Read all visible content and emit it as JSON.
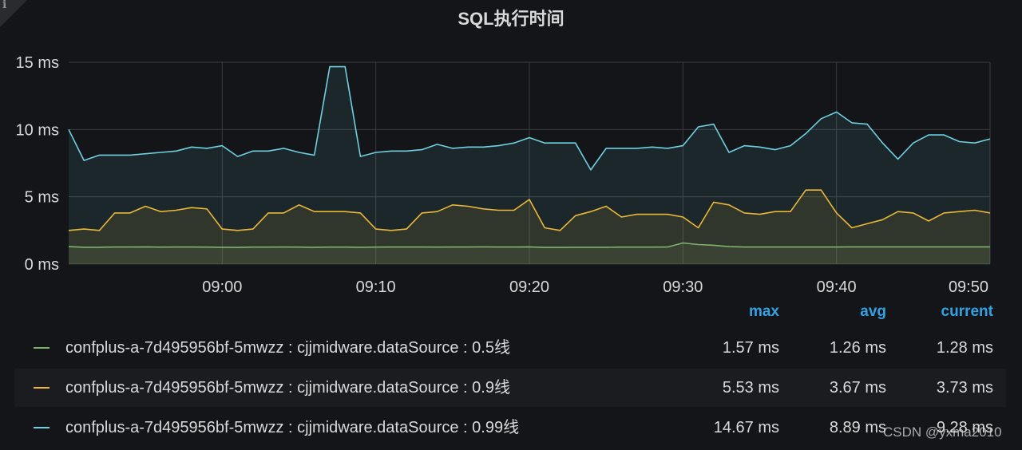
{
  "panel": {
    "title": "SQL执行时间",
    "info_icon": "info-icon"
  },
  "chart_data": {
    "type": "area",
    "title": "SQL执行时间",
    "xlabel": "",
    "ylabel": "",
    "x_start": "08:50",
    "x_step_minutes": 1,
    "xlim_minutes": [
      0,
      60
    ],
    "ylim": [
      0,
      15
    ],
    "yticks": [
      "0 ms",
      "5 ms",
      "10 ms",
      "15 ms"
    ],
    "ytick_values": [
      0,
      5,
      10,
      15
    ],
    "xticks": [
      "09:00",
      "09:10",
      "09:20",
      "09:30",
      "09:40",
      "09:50"
    ],
    "xtick_minutes": [
      10,
      20,
      30,
      40,
      50,
      60
    ],
    "grid": true,
    "series": [
      {
        "name": "confplus-a-7d495956bf-5mwzz : cjjmidware.dataSource : 0.5线",
        "color": "#7eb26d",
        "values": [
          1.3,
          1.25,
          1.25,
          1.27,
          1.27,
          1.28,
          1.26,
          1.27,
          1.27,
          1.26,
          1.25,
          1.24,
          1.26,
          1.26,
          1.27,
          1.26,
          1.25,
          1.26,
          1.26,
          1.25,
          1.26,
          1.27,
          1.27,
          1.27,
          1.26,
          1.27,
          1.27,
          1.28,
          1.27,
          1.27,
          1.28,
          1.24,
          1.24,
          1.25,
          1.25,
          1.25,
          1.26,
          1.26,
          1.26,
          1.27,
          1.57,
          1.45,
          1.4,
          1.3,
          1.27,
          1.27,
          1.27,
          1.27,
          1.27,
          1.27,
          1.27,
          1.28,
          1.28,
          1.28,
          1.28,
          1.28,
          1.28,
          1.28,
          1.28,
          1.28,
          1.28
        ]
      },
      {
        "name": "confplus-a-7d495956bf-5mwzz : cjjmidware.dataSource : 0.9线",
        "color": "#eab839",
        "values": [
          2.5,
          2.6,
          2.5,
          3.8,
          3.8,
          4.3,
          3.9,
          4.0,
          4.2,
          4.1,
          2.6,
          2.5,
          2.6,
          3.8,
          3.8,
          4.4,
          3.9,
          3.9,
          3.9,
          3.8,
          2.6,
          2.5,
          2.6,
          3.8,
          3.9,
          4.4,
          4.3,
          4.1,
          4.0,
          4.0,
          4.8,
          2.7,
          2.5,
          3.6,
          3.9,
          4.3,
          3.5,
          3.7,
          3.7,
          3.7,
          3.5,
          2.7,
          4.6,
          4.4,
          3.8,
          3.7,
          3.9,
          3.9,
          5.5,
          5.5,
          3.8,
          2.7,
          3.0,
          3.3,
          3.9,
          3.8,
          3.2,
          3.8,
          3.9,
          4.0,
          3.8
        ]
      },
      {
        "name": "confplus-a-7d495956bf-5mwzz : cjjmidware.dataSource : 0.99线",
        "color": "#6ed0e0",
        "values": [
          10.0,
          7.7,
          8.1,
          8.1,
          8.1,
          8.2,
          8.3,
          8.4,
          8.7,
          8.6,
          8.8,
          8.0,
          8.4,
          8.4,
          8.6,
          8.3,
          8.1,
          14.67,
          14.67,
          8.0,
          8.3,
          8.4,
          8.4,
          8.5,
          8.9,
          8.6,
          8.7,
          8.7,
          8.8,
          9.0,
          9.4,
          9.0,
          9.0,
          9.0,
          7.0,
          8.6,
          8.6,
          8.6,
          8.7,
          8.6,
          8.8,
          10.2,
          10.4,
          8.3,
          8.8,
          8.7,
          8.5,
          8.8,
          9.7,
          10.8,
          11.3,
          10.5,
          10.4,
          9.0,
          7.8,
          9.0,
          9.6,
          9.6,
          9.1,
          9.0,
          9.3
        ]
      }
    ]
  },
  "legend": {
    "headers": {
      "max": "max",
      "avg": "avg",
      "current": "current"
    },
    "rows": [
      {
        "label": "confplus-a-7d495956bf-5mwzz : cjjmidware.dataSource : 0.5线",
        "max": "1.57 ms",
        "avg": "1.26 ms",
        "current": "1.28 ms"
      },
      {
        "label": "confplus-a-7d495956bf-5mwzz : cjjmidware.dataSource : 0.9线",
        "max": "5.53 ms",
        "avg": "3.67 ms",
        "current": "3.73 ms"
      },
      {
        "label": "confplus-a-7d495956bf-5mwzz : cjjmidware.dataSource : 0.99线",
        "max": "14.67 ms",
        "avg": "8.89 ms",
        "current": "9.28 ms"
      }
    ]
  },
  "watermark": "CSDN @yxma2010"
}
